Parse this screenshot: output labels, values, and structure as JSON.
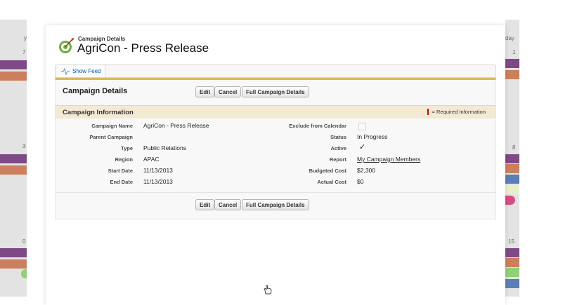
{
  "background": {
    "left_day_labels": [
      "y",
      "7",
      "3",
      "0"
    ],
    "right_day_labels": [
      "day",
      "1",
      "8",
      "15"
    ]
  },
  "header": {
    "subtitle": "Campaign Details",
    "title": "AgriCon - Press Release"
  },
  "feed": {
    "show_feed_label": "Show Feed"
  },
  "panel": {
    "title": "Campaign Details",
    "buttons": {
      "edit": "Edit",
      "cancel": "Cancel",
      "full_details": "Full Campaign Details"
    }
  },
  "section": {
    "title": "Campaign Information",
    "required_note": "= Required Information"
  },
  "fields_left": [
    {
      "label": "Campaign Name",
      "value": "AgriCon - Press Release"
    },
    {
      "label": "Parent Campaign",
      "value": ""
    },
    {
      "label": "Type",
      "value": "Public Relations"
    },
    {
      "label": "Region",
      "value": "APAC"
    },
    {
      "label": "Start Date",
      "value": "11/13/2013"
    },
    {
      "label": "End Date",
      "value": "11/13/2013"
    }
  ],
  "fields_right": [
    {
      "label": "Exclude from Calendar",
      "checked": false
    },
    {
      "label": "Status",
      "value": "In Progress"
    },
    {
      "label": "Active",
      "checked": true
    },
    {
      "label": "Report",
      "value": "My Campaign Members"
    },
    {
      "label": "Budgeted Cost",
      "value": "$2,300"
    },
    {
      "label": "Actual Cost",
      "value": "$0"
    }
  ],
  "colors": {
    "accent_gold": "#d9b95c",
    "section_bg": "#f3ead4",
    "link_blue": "#015ba7",
    "calendar_purple": "#7e4a86",
    "calendar_orange": "#cc7f5c",
    "calendar_green": "#8fd17a",
    "calendar_blue": "#5b7fb5",
    "calendar_pink": "#d94b86"
  }
}
